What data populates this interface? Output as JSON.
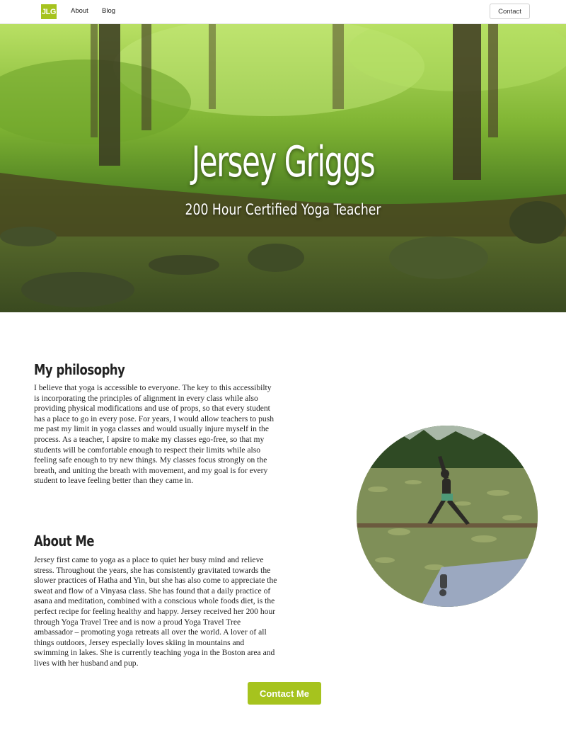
{
  "nav": {
    "logo": "JLG",
    "links": [
      {
        "label": "About"
      },
      {
        "label": "Blog"
      }
    ],
    "contact_label": "Contact"
  },
  "hero": {
    "title": "Jersey Griggs",
    "subtitle": "200 Hour Certified Yoga Teacher"
  },
  "philosophy": {
    "heading": "My philosophy",
    "body": "I believe that yoga is accessible to everyone. The key to this accessibilty is incorporating the principles of alignment in every class while also providing physical modifications and use of props, so that every student has a place to go in every pose. For years, I would allow teachers to push me past my limit in yoga classes and would usually injure myself in the process. As a teacher, I apsire to make my classes ego-free, so that my students will be comfortable enough to respect their limits while also feeling safe enough to try new things. My classes focus strongly on the breath, and uniting the breath with movement, and my goal is for every student to leave feeling better than they came in."
  },
  "about": {
    "heading": "About Me",
    "body": "Jersey first came to yoga as a place to quiet her busy mind and relieve stress. Throughout the years, she has consistently gravitated towards the slower practices of Hatha and Yin, but she has also come to appreciate the sweat and flow of a Vinyasa class. She has found that a daily practice of asana and meditation, combined with a conscious whole foods diet, is the perfect recipe for feeling healthy and happy. Jersey received her 200 hour through Yoga Travel Tree and is now a proud Yoga Travel Tree ambassador – promoting yoga retreats all over the world. A lover of all things outdoors, Jersey especially loves skiing in mountains and swimming in lakes. She is currently teaching yoga in the Boston area and lives with her husband and pup."
  },
  "cta": {
    "label": "Contact Me"
  },
  "colors": {
    "accent": "#a6c31e"
  }
}
